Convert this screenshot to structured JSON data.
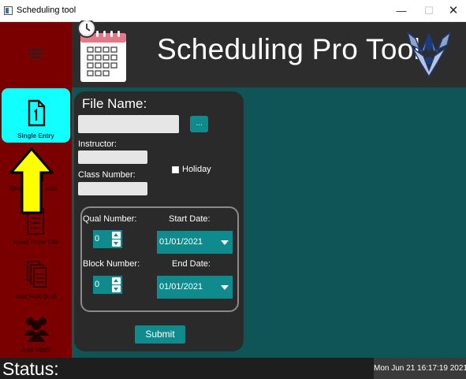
{
  "window": {
    "title": "Scheduling tool",
    "min_label": "—",
    "max_label": "☐",
    "close_label": "✕"
  },
  "header": {
    "title": "Scheduling Pro Tool"
  },
  "sidebar": {
    "items": [
      {
        "label": "Single Entry",
        "icon": "document-1-icon",
        "active": true
      },
      {
        "label": "New Workbook",
        "icon": "workbook-icon"
      },
      {
        "label": "Read From File",
        "icon": "list-file-icon"
      },
      {
        "label": "Add Full Qual",
        "icon": "stacked-docs-icon"
      },
      {
        "label": "Add MINS",
        "icon": "people-icon"
      }
    ],
    "visible_labels": {
      "new_workbook_left": "New",
      "new_workbook_right": "ook"
    }
  },
  "form": {
    "file_name_label": "File Name:",
    "browse_label": "...",
    "instructor_label": "Instructor:",
    "class_number_label": "Class Number:",
    "holiday_label": "Holiday",
    "qual_number_label": "Qual Number:",
    "qual_number_value": "0",
    "start_date_label": "Start Date:",
    "start_date_value": "01/01/2021",
    "block_number_label": "Block Number:",
    "block_number_value": "0",
    "end_date_label": "End Date:",
    "end_date_value": "01/01/2021",
    "submit_label": "Submit",
    "file_name_value": "",
    "instructor_value": "",
    "class_number_value": ""
  },
  "status": {
    "label": "Status:",
    "datetime": "Mon Jun 21 16:17:19 2021"
  },
  "colors": {
    "sidebar": "#7a0000",
    "active": "#12ffff",
    "accent": "#0f8b8d",
    "main_bg": "#0f5558",
    "arrow": "#ffff00"
  }
}
